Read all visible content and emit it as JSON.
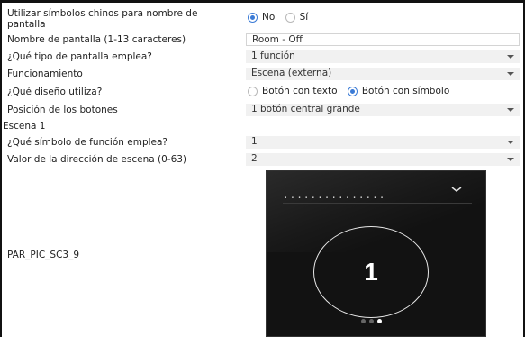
{
  "form": {
    "chinese_symbols": {
      "label": "Utilizar símbolos chinos para nombre de pantalla",
      "options": [
        "No",
        "Sí"
      ],
      "selected": "No"
    },
    "screen_name": {
      "label": "Nombre de pantalla (1-13 caracteres)",
      "value": "Room - Off"
    },
    "screen_type": {
      "label": "¿Qué tipo de pantalla emplea?",
      "value": "1 función"
    },
    "operation": {
      "label": "Funcionamiento",
      "value": "Escena (externa)"
    },
    "design": {
      "label": "¿Qué diseño utiliza?",
      "options": [
        "Botón con texto",
        "Botón con símbolo"
      ],
      "selected": "Botón con símbolo"
    },
    "button_position": {
      "label": "Posición de los botones",
      "value": "1 botón central grande"
    },
    "section_title": "Escena 1",
    "function_symbol": {
      "label": "¿Qué símbolo de función emplea?",
      "value": "1"
    },
    "scene_address": {
      "label": "Valor de la dirección de escena (0-63)",
      "value": "2"
    }
  },
  "preview": {
    "label": "PAR_PIC_SC3_9",
    "dashes": "...............",
    "big_number": "1",
    "page_dots_total": 3,
    "page_dots_active_index": 2
  },
  "colors": {
    "accent": "#3b7bd6",
    "preview_bg": "#121212",
    "select_bg": "#f1f1f1"
  }
}
